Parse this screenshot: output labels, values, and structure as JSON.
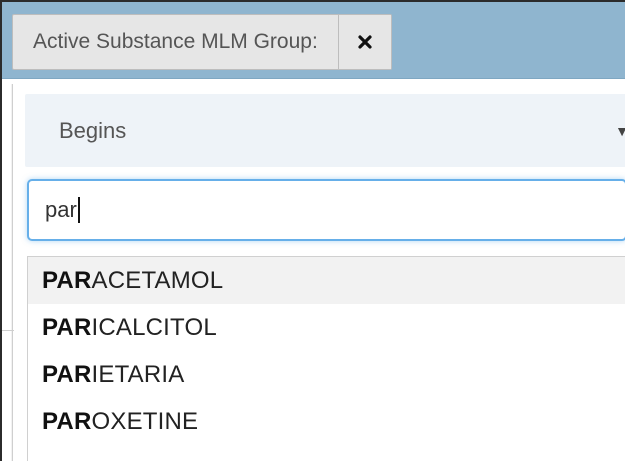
{
  "filter_chip": {
    "label": "Active Substance MLM Group:",
    "close_icon": "close-x-icon"
  },
  "operator_select": {
    "value": "Begins",
    "caret_icon": "caret-down-icon"
  },
  "search": {
    "value": "par"
  },
  "results": [
    {
      "match": "PAR",
      "rest": "ACETAMOL"
    },
    {
      "match": "PAR",
      "rest": "ICALCITOL"
    },
    {
      "match": "PAR",
      "rest": "IETARIA"
    },
    {
      "match": "PAR",
      "rest": "OXETINE"
    }
  ],
  "colors": {
    "header_background": "#8fb5cf",
    "input_focus_border": "#66afe9",
    "highlight_row": "#f2f2f2"
  }
}
